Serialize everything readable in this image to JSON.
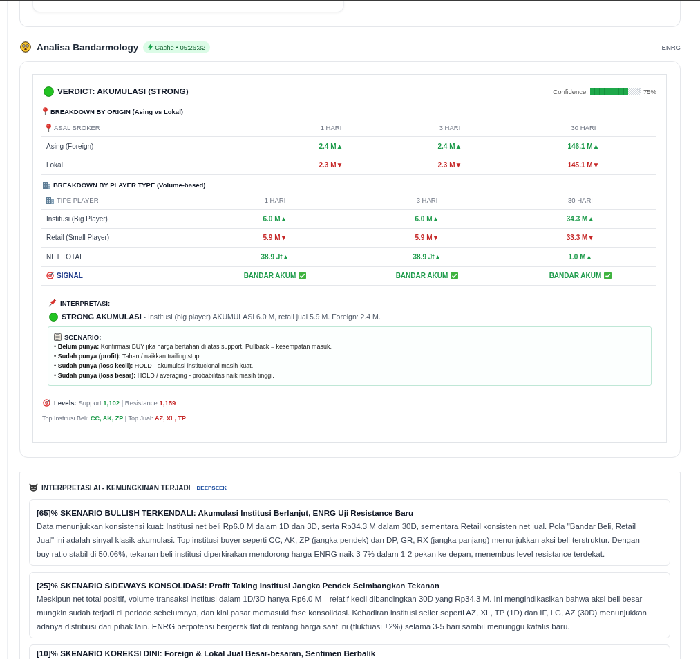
{
  "header": {
    "title": "Analisa Bandarmology",
    "badge": "Cache • 05:26:32",
    "ticker": "ENRG"
  },
  "verdict": {
    "title": "VERDICT: AKUMULASI (STRONG)",
    "confidence_label": "Confidence:",
    "confidence": {
      "level": 0.75
    },
    "confidence_value": "75%"
  },
  "origin_breakdown": {
    "title": "BREAKDOWN BY ORIGIN (Asing vs Lokal)",
    "columns": [
      "ASAL BROKER",
      "1 HARI",
      "3 HARI",
      "30 HARI"
    ],
    "rows": [
      {
        "kind": "value",
        "cells": [
          {
            "text": "Asing (Foreign)"
          },
          {
            "text": "2.4 M▲",
            "positive": true
          },
          {
            "text": "2.4 M▲",
            "positive": true
          },
          {
            "text": "146.1 M▲",
            "positive": true
          }
        ]
      },
      {
        "kind": "value",
        "cells": [
          {
            "text": "Lokal"
          },
          {
            "text": "2.3 M▼",
            "positive": false
          },
          {
            "text": "2.3 M▼",
            "positive": false
          },
          {
            "text": "145.1 M▼",
            "positive": false
          }
        ]
      }
    ]
  },
  "player_breakdown": {
    "title": "BREAKDOWN BY PLAYER TYPE (Volume-based)",
    "columns": [
      "TIPE PLAYER",
      "1 HARI",
      "3 HARI",
      "30 HARI"
    ],
    "rows": [
      {
        "kind": "value",
        "cells": [
          {
            "text": "Institusi (Big Player)"
          },
          {
            "text": "6.0 M▲",
            "positive": true
          },
          {
            "text": "6.0 M▲",
            "positive": true
          },
          {
            "text": "34.3 M▲",
            "positive": true
          }
        ]
      },
      {
        "kind": "value",
        "cells": [
          {
            "text": "Retail (Small Player)"
          },
          {
            "text": "5.9 M▼",
            "positive": false
          },
          {
            "text": "5.9 M▼",
            "positive": false
          },
          {
            "text": "33.3 M▼",
            "positive": false
          }
        ]
      },
      {
        "kind": "value",
        "cells": [
          {
            "text": "NET TOTAL"
          },
          {
            "text": "38.9 Jt▲",
            "positive": true
          },
          {
            "text": "38.9 Jt▲",
            "positive": true
          },
          {
            "text": "1.0 M▲",
            "positive": true
          }
        ]
      },
      {
        "kind": "signal",
        "cells": [
          {
            "text": "SIGNAL"
          },
          {
            "text": "BANDAR AKUM",
            "positive": true
          },
          {
            "text": "BANDAR AKUM",
            "positive": true
          },
          {
            "text": "BANDAR AKUM",
            "positive": true
          }
        ]
      }
    ]
  },
  "interpretation": {
    "title": "INTERPRETASI:",
    "summary": "**STRONG AKUMULASI** - Institusi (big player) AKUMULASI 6.0 M, retail jual 5.9 M. Foreign: 2.4 M.",
    "scenario": {
      "title": "SCENARIO:",
      "items": [
        "• **Belum punya:** Konfirmasi BUY jika harga bertahan di atas support. Pullback = kesempatan masuk.",
        "• **Sudah punya (profit):** Tahan / naikkan trailing stop.",
        "• **Sudah punya (loss kecil):** HOLD - akumulasi institucional masih kuat.",
        "• **Sudah punya (loss besar):** HOLD / averaging - probabilitas naik masih tinggi."
      ]
    }
  },
  "levels": [
    {
      "kind": "label",
      "text": "Levels:"
    },
    {
      "kind": "text",
      "text": " Support "
    },
    {
      "kind": "positive",
      "text": "1,102"
    },
    {
      "kind": "text",
      "text": " | Resistance "
    },
    {
      "kind": "negative",
      "text": "1,159"
    }
  ],
  "top_brokers": [
    {
      "kind": "text",
      "text": "Top Institusi Beli: "
    },
    {
      "kind": "positive",
      "text": "CC, AK, ZP"
    },
    {
      "kind": "text",
      "text": " | Top Jual: "
    },
    {
      "kind": "negative",
      "text": "AZ, XL, TP"
    }
  ],
  "ai_interpretation": {
    "title": "INTERPRETASI AI - KEMUNGKINAN TERJADI",
    "source": "DEEPSEEK",
    "scenarios": [
      {
        "title": "[65]% SKENARIO BULLISH TERKENDALI: Akumulasi Institusi Berlanjut, ENRG Uji Resistance Baru",
        "body": "Data menunjukkan konsistensi kuat: Institusi net beli Rp6.0 M dalam 1D dan 3D, serta Rp34.3 M dalam 30D, sementara Retail konsisten net jual. Pola \"Bandar Beli, Retail Jual\" ini adalah sinyal klasik akumulasi. Top institusi buyer seperti CC, AK, ZP (jangka pendek) dan DP, GR, RX (jangka panjang) menunjukkan aksi beli terstruktur. Dengan buy ratio stabil di 50.06%, tekanan beli institusi diperkirakan mendorong harga ENRG naik 3-7% dalam 1-2 pekan ke depan, menembus level resistance terdekat."
      },
      {
        "title": "[25]% SKENARIO SIDEWAYS KONSOLIDASI: Profit Taking Institusi Jangka Pendek Seimbangkan Tekanan",
        "body": "Meskipun net total positif, volume transaksi institusi dalam 1D/3D hanya Rp6.0 M—relatif kecil dibandingkan 30D yang Rp34.3 M. Ini mengindikasikan bahwa aksi beli besar mungkin sudah terjadi di periode sebelumnya, dan kini pasar memasuki fase konsolidasi. Kehadiran institusi seller seperti AZ, XL, TP (1D) dan IF, LG, AZ (30D) menunjukkan adanya distribusi dari pihak lain. ENRG berpotensi bergerak flat di rentang harga saat ini (fluktuasi ±2%) selama 3-5 hari sambil menunggu katalis baru."
      },
      {
        "title": "[10]% SKENARIO KOREKSI DINI: Foreign & Lokal Jual Besar-besaran, Sentimen Berbalik"
      }
    ]
  }
}
